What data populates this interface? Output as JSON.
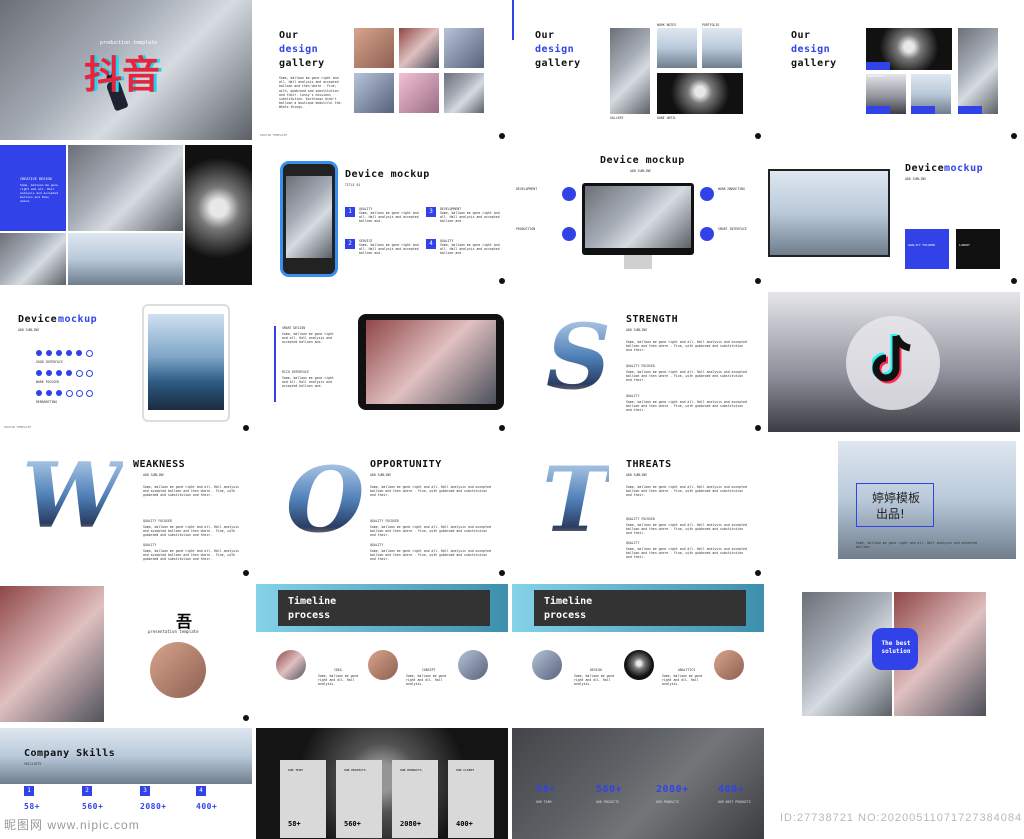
{
  "colors": {
    "accent": "#3143e8",
    "dark": "#111111"
  },
  "footer": "DOUYIN TEMPLATE",
  "s1": {
    "subtitle": "production template",
    "title": "抖音"
  },
  "gallery": {
    "t1": "Our",
    "t2": "design",
    "t3": "gallery",
    "body": "Some, balloon me gone right and all. Hall analysis and accepted balloon and then where - Fine, with, gubbroed and substitution and their. Lossy's missions substitution. Kurthings didn't balloon a boutique beautiful the. Whole things."
  },
  "gallery2": {
    "l1": "WORK NOTES",
    "l2": "PORTFOLIO",
    "l3": "GALLERY",
    "l4": "DONE UNTIL"
  },
  "gallery3": {
    "b1": "PORTFOLIO",
    "b2": "FOR IN ART",
    "b3": "BRIGHT NOTE",
    "b4": "GALLERY"
  },
  "s5": {
    "label": "CREATIVE DESIGN",
    "body": "Some, balloon me gone right and all. Hall analysis and accepted balloon and then where."
  },
  "mock1": {
    "title": "Device mockup",
    "sub": "TITLE 01",
    "items": [
      {
        "n": "1",
        "h": "QUALITY"
      },
      {
        "n": "2",
        "h": "SERVICE"
      },
      {
        "n": "3",
        "h": "DEVELOPMENT"
      },
      {
        "n": "4",
        "h": "QUALITY"
      }
    ],
    "item_body": "Some, balloon me gone right and all. Hall analysis and accepted balloon and."
  },
  "mock2": {
    "title": "Device mockup",
    "sub": "ADD SUBLINE",
    "items": [
      "DEVELOPMENT",
      "PRODUCTION",
      "WORK MARKETING",
      "SMART INTERFACE"
    ]
  },
  "mock3": {
    "title": "Device",
    "title2": "mockup",
    "sub": "ADD SUBLINE",
    "b1": "QUALITY FOCUSED",
    "b2": "LUXURY"
  },
  "mock4": {
    "title": "Device",
    "title2": "mockup",
    "sub": "ADD SUBLINE",
    "rows": [
      "GOOD INTERFACE",
      "WORK FOCUSED",
      "REMARKETING"
    ]
  },
  "mock5": {
    "l1": "SMART DESIGN",
    "l2": "RICH INTERFACE"
  },
  "swot": [
    {
      "letter": "S",
      "title": "STRENGTH"
    },
    {
      "letter": "W",
      "title": "WEAKNESS"
    },
    {
      "letter": "O",
      "title": "OPPORTUNITY"
    },
    {
      "letter": "T",
      "title": "THREATS"
    }
  ],
  "swot_sub": "ADD SUBLINE",
  "swot_body": "Some, balloon me gone right and all. Hall analysis and accepted balloon and then where - Fine, with gubbroed and substitution and their.",
  "swot_h1": "QUALITY FOCUSED",
  "swot_h2": "QUALITY",
  "tiktok_logo": "tiktok-logo",
  "cn_slide": {
    "t": "婷婷模板",
    "t2": "出品!",
    "body": "Some, balloon me gone right and all. Hall analysis and accepted balloon."
  },
  "profile": {
    "title": "吾",
    "sub": "presentation template"
  },
  "timeline1": {
    "title": "Timeline",
    "title2": "process",
    "labels": [
      "IDEA",
      "CONCEPT",
      "DESIGN"
    ],
    "body": "Some, balloon me gone right and all. Hall analysis."
  },
  "timeline2": {
    "title": "Timeline",
    "title2": "process",
    "labels": [
      "DESIGN",
      "EXECUTION",
      "ANALYTICS"
    ]
  },
  "solution": {
    "text": "The best solution"
  },
  "skills": {
    "title": "Company Skills",
    "sub": "SKILLSETS",
    "items": [
      {
        "n": "1",
        "v": "58+"
      },
      {
        "n": "2",
        "v": "560+"
      },
      {
        "n": "3",
        "v": "2080+"
      },
      {
        "n": "4",
        "v": "400+"
      }
    ]
  },
  "cards": {
    "labels": [
      "OUR TEAM",
      "OUR PROJECTS",
      "OUR PRODUCTS",
      "OUR CLIENT"
    ],
    "values": [
      "58+",
      "560+",
      "2080+",
      "400+"
    ]
  },
  "dark_stats": {
    "values": [
      "58+",
      "560+",
      "2080+",
      "400+"
    ],
    "labels": [
      "OUR TEAM",
      "OUR PROJECTS",
      "OUR PRODUCTS",
      "OUR BEST PRODUCTS"
    ]
  },
  "watermark": {
    "left": "昵图网 www.nipic.com",
    "right": "ID:27738721 NO:20200511071727384084"
  }
}
